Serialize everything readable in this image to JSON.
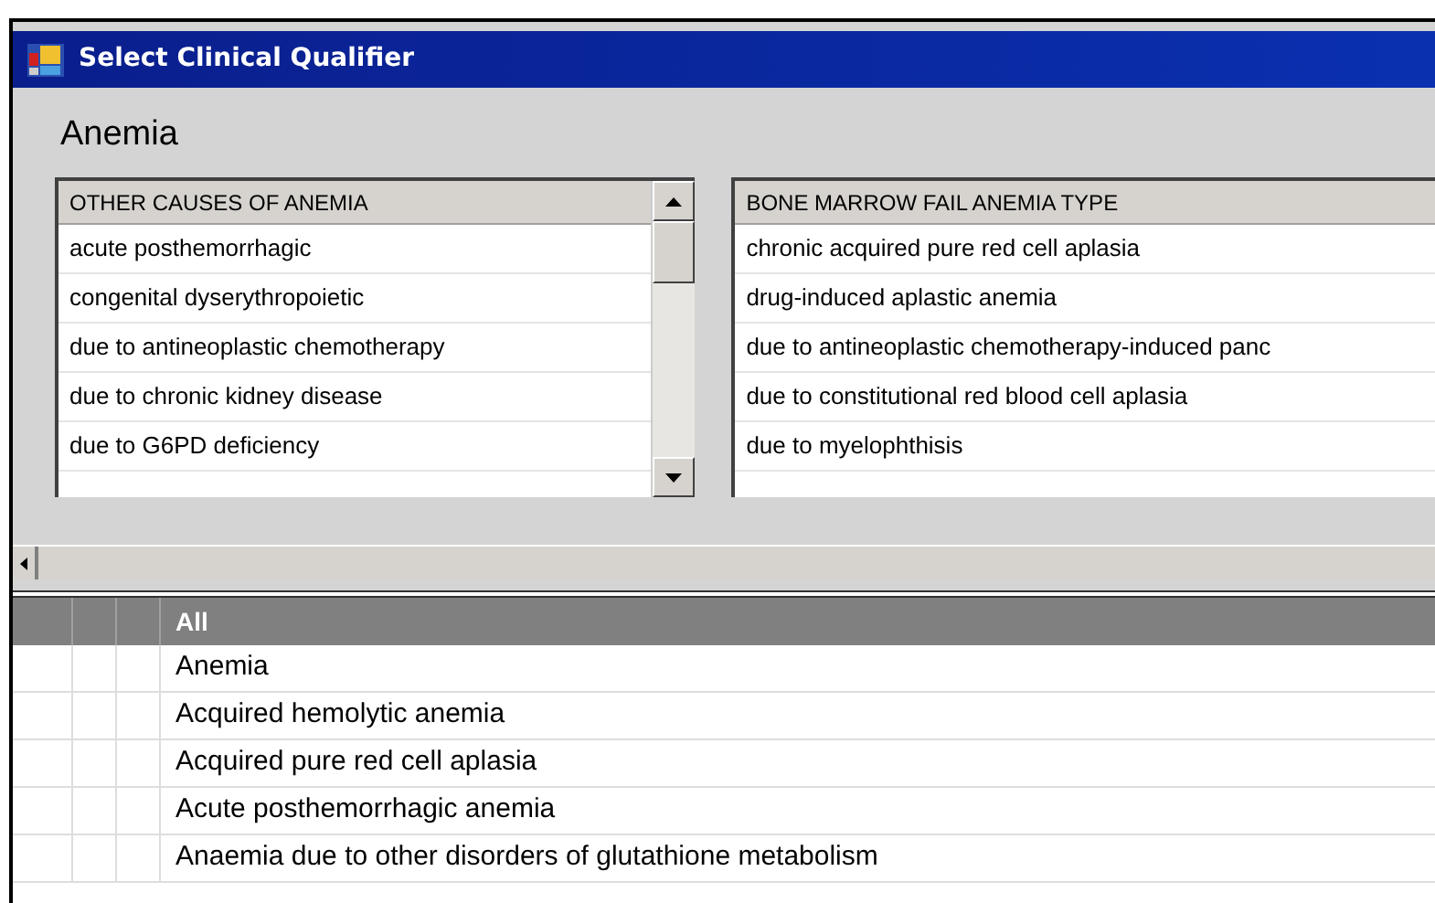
{
  "window": {
    "title": "Select Clinical Qualifier"
  },
  "heading": "Anemia",
  "lists": [
    {
      "header": "OTHER CAUSES OF ANEMIA",
      "scrollbar": true,
      "items": [
        "acute posthemorrhagic",
        "congenital dyserythropoietic",
        "due to antineoplastic chemotherapy",
        "due to chronic kidney disease",
        "due to G6PD deficiency"
      ]
    },
    {
      "header": "BONE MARROW FAIL ANEMIA TYPE",
      "scrollbar": false,
      "items": [
        "chronic acquired pure red cell aplasia",
        "drug-induced aplastic anemia",
        "due to antineoplastic chemotherapy-induced panc",
        "due to constitutional red blood cell aplasia",
        "due to myelophthisis"
      ]
    }
  ],
  "grid": {
    "header": "All",
    "rows": [
      "Anemia",
      "Acquired hemolytic anemia",
      "Acquired pure red cell aplasia",
      "Acute posthemorrhagic anemia",
      "Anaemia due to other disorders of glutathione metabolism"
    ]
  }
}
